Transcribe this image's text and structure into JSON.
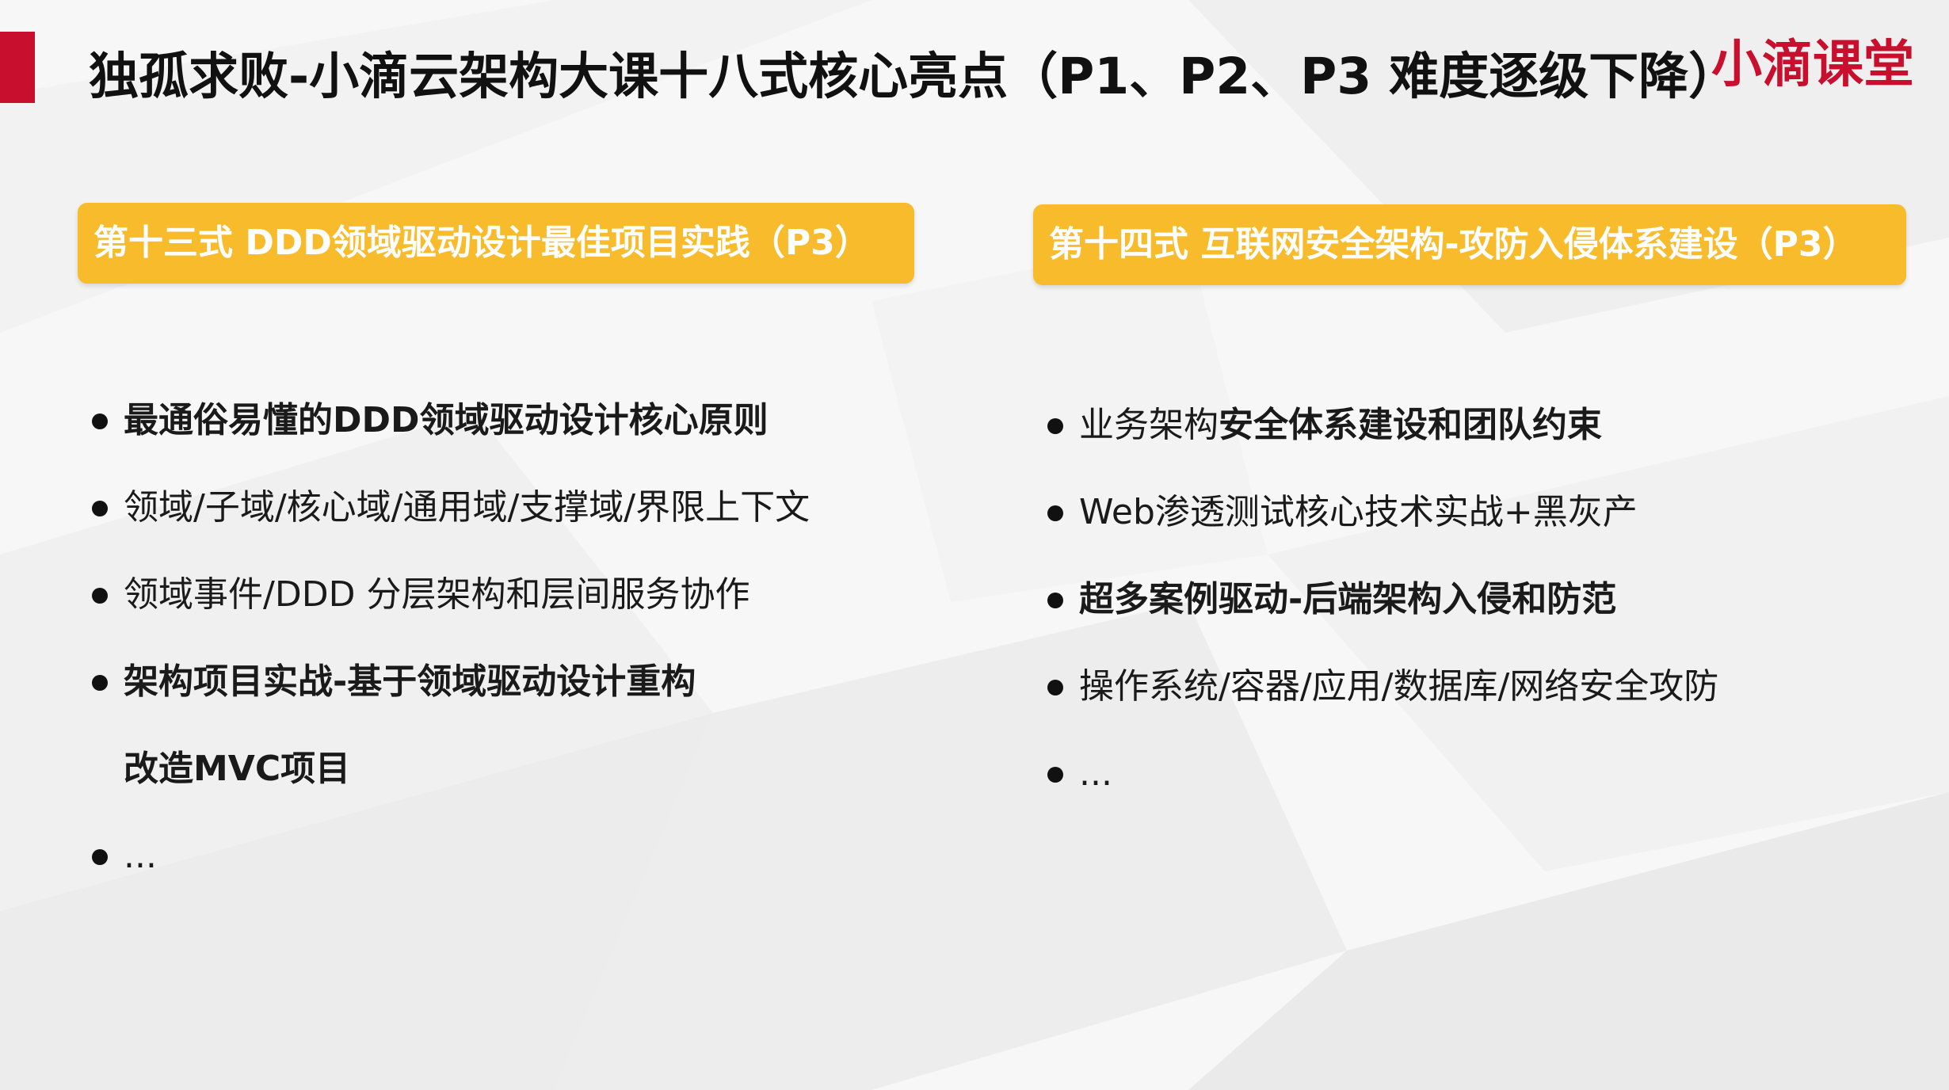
{
  "page": {
    "title": "独孤求败-小滴云架构大课十八式核心亮点（P1、P2、P3 难度逐级下降）",
    "logo": "小滴课堂"
  },
  "colors": {
    "accent_red": "#c8102e",
    "header_yellow": "#f7bb2c",
    "text_dark": "#1a1a1a"
  },
  "left": {
    "header": "第十三式 DDD领域驱动设计最佳项目实践（P3）",
    "items": [
      {
        "bold": "最通俗易懂的DDD领域驱动设计核心原则",
        "normal": ""
      },
      {
        "bold": "",
        "normal": "领域/子域/核心域/通用域/支撑域/界限上下文"
      },
      {
        "bold": "",
        "normal": "领域事件/DDD 分层架构和层间服务协作"
      },
      {
        "bold": "架构项目实战-基于领域驱动设计重构",
        "normal": ""
      },
      {
        "bold": "改造MVC项目",
        "normal": ""
      },
      {
        "bold": "",
        "normal": "..."
      }
    ]
  },
  "right": {
    "header": "第十四式 互联网安全架构-攻防入侵体系建设（P3）",
    "items": [
      {
        "normal": "业务架构",
        "bold": "安全体系建设和团队约束"
      },
      {
        "normal": "Web渗透测试核心技术实战+黑灰产",
        "bold": ""
      },
      {
        "normal": "",
        "bold": "超多案例驱动-后端架构入侵和防范"
      },
      {
        "normal": "操作系统/容器/应用/数据库/网络安全攻防",
        "bold": ""
      },
      {
        "normal": "...",
        "bold": ""
      }
    ]
  }
}
